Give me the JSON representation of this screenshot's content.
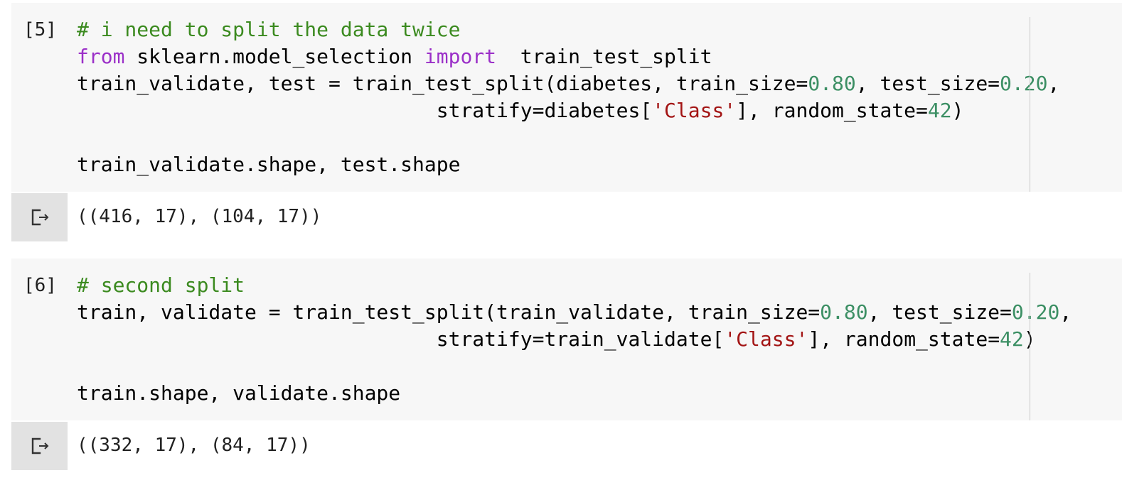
{
  "cells": [
    {
      "exec_count": "[5]",
      "code_lines": [
        [
          {
            "text": "# i need to split the data twice",
            "kind": "comment"
          }
        ],
        [
          {
            "text": "from",
            "kind": "keyword"
          },
          {
            "text": " sklearn.model_selection ",
            "kind": "plain"
          },
          {
            "text": "import",
            "kind": "keyword"
          },
          {
            "text": "  train_test_split",
            "kind": "plain"
          }
        ],
        [
          {
            "text": "train_validate, test = train_test_split(diabetes, train_size=",
            "kind": "plain"
          },
          {
            "text": "0.80",
            "kind": "number"
          },
          {
            "text": ", test_size=",
            "kind": "plain"
          },
          {
            "text": "0.20",
            "kind": "number"
          },
          {
            "text": ",",
            "kind": "plain"
          }
        ],
        [
          {
            "text": "                              stratify=diabetes[",
            "kind": "plain"
          },
          {
            "text": "'Class'",
            "kind": "string"
          },
          {
            "text": "], random_state=",
            "kind": "plain"
          },
          {
            "text": "42",
            "kind": "number"
          },
          {
            "text": ")",
            "kind": "plain"
          }
        ],
        [],
        [
          {
            "text": "train_validate.shape, test.shape",
            "kind": "plain"
          }
        ]
      ],
      "output": "((416, 17), (104, 17))"
    },
    {
      "exec_count": "[6]",
      "code_lines": [
        [
          {
            "text": "# second split",
            "kind": "comment"
          }
        ],
        [
          {
            "text": "train, validate = train_test_split(train_validate, train_size=",
            "kind": "plain"
          },
          {
            "text": "0.80",
            "kind": "number"
          },
          {
            "text": ", test_size=",
            "kind": "plain"
          },
          {
            "text": "0.20",
            "kind": "number"
          },
          {
            "text": ",",
            "kind": "plain"
          }
        ],
        [
          {
            "text": "                              stratify=train_validate[",
            "kind": "plain"
          },
          {
            "text": "'Class'",
            "kind": "string"
          },
          {
            "text": "], random_state=",
            "kind": "plain"
          },
          {
            "text": "42",
            "kind": "number"
          },
          {
            "text": ")",
            "kind": "plain"
          }
        ],
        [],
        [
          {
            "text": "train.shape, validate.shape",
            "kind": "plain"
          }
        ]
      ],
      "output": "((332, 17), (84, 17))"
    }
  ],
  "colors": {
    "comment": "#3b8a1f",
    "keyword": "#9b30c8",
    "number": "#3c8f64",
    "string": "#a31515",
    "code_background": "#f7f7f7",
    "output_icon_background": "#e2e2e2"
  },
  "icons": {
    "output": "output-arrow-icon"
  }
}
